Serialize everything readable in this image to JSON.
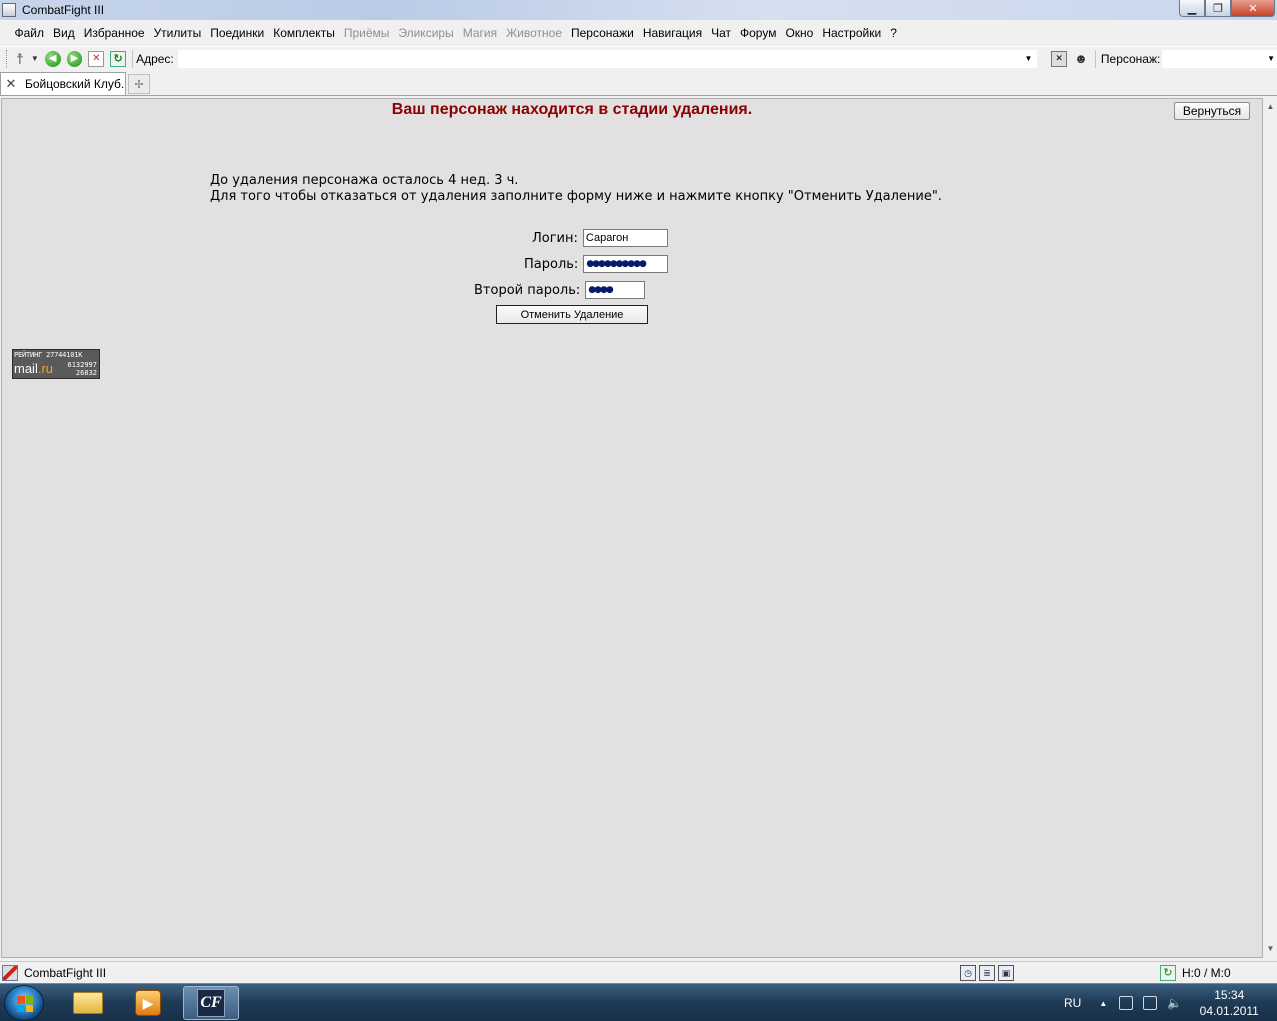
{
  "window": {
    "title": "CombatFight III",
    "btn_min": "▁",
    "btn_max": "❐",
    "btn_close": "✕"
  },
  "menu": [
    "Файл",
    "Вид",
    "Избранное",
    "Утилиты",
    "Поединки",
    "Комплекты",
    "Приёмы",
    "Эликсиры",
    "Магия",
    "Животное",
    "Персонажи",
    "Навигация",
    "Чат",
    "Форум",
    "Окно",
    "Настройки",
    "?"
  ],
  "menu_disabled": [
    "Приёмы",
    "Эликсиры",
    "Магия",
    "Животное"
  ],
  "toolbar": {
    "address_label": "Адрес:",
    "address_value": "",
    "character_label": "Персонаж:",
    "character_value": ""
  },
  "tabs": [
    {
      "label": "Бойцовский Клуб."
    }
  ],
  "page": {
    "heading": "Ваш персонаж находится в стадии удаления.",
    "back_button": "Вернуться",
    "line1": "До удаления персонажа осталось 4 нед. 3 ч.",
    "line2": "Для того чтобы отказаться от удаления заполните форму ниже и нажмите кнопку \"Отменить Удаление\".",
    "login_label": "Логин:",
    "login_value": "Сарагон",
    "password_label": "Пароль:",
    "password_mask": "●●●●●●●●●●",
    "second_password_label": "Второй пароль:",
    "second_password_mask": "●●●●",
    "submit_button": "Отменить Удаление"
  },
  "counter": {
    "line1": "РЕЙТИНГ 27744101К",
    "brand_mail": "mail",
    "brand_ru": ".ru",
    "stat1": "6132997",
    "stat2": "26832"
  },
  "statusbar": {
    "title": "CombatFight III",
    "counts": "H:0 / M:0"
  },
  "taskbar": {
    "cf_label": "CF",
    "lang": "RU",
    "time": "15:34",
    "date": "04.01.2011"
  },
  "colors": {
    "heading": "#8b0000",
    "content_bg": "#e2e0e0"
  }
}
